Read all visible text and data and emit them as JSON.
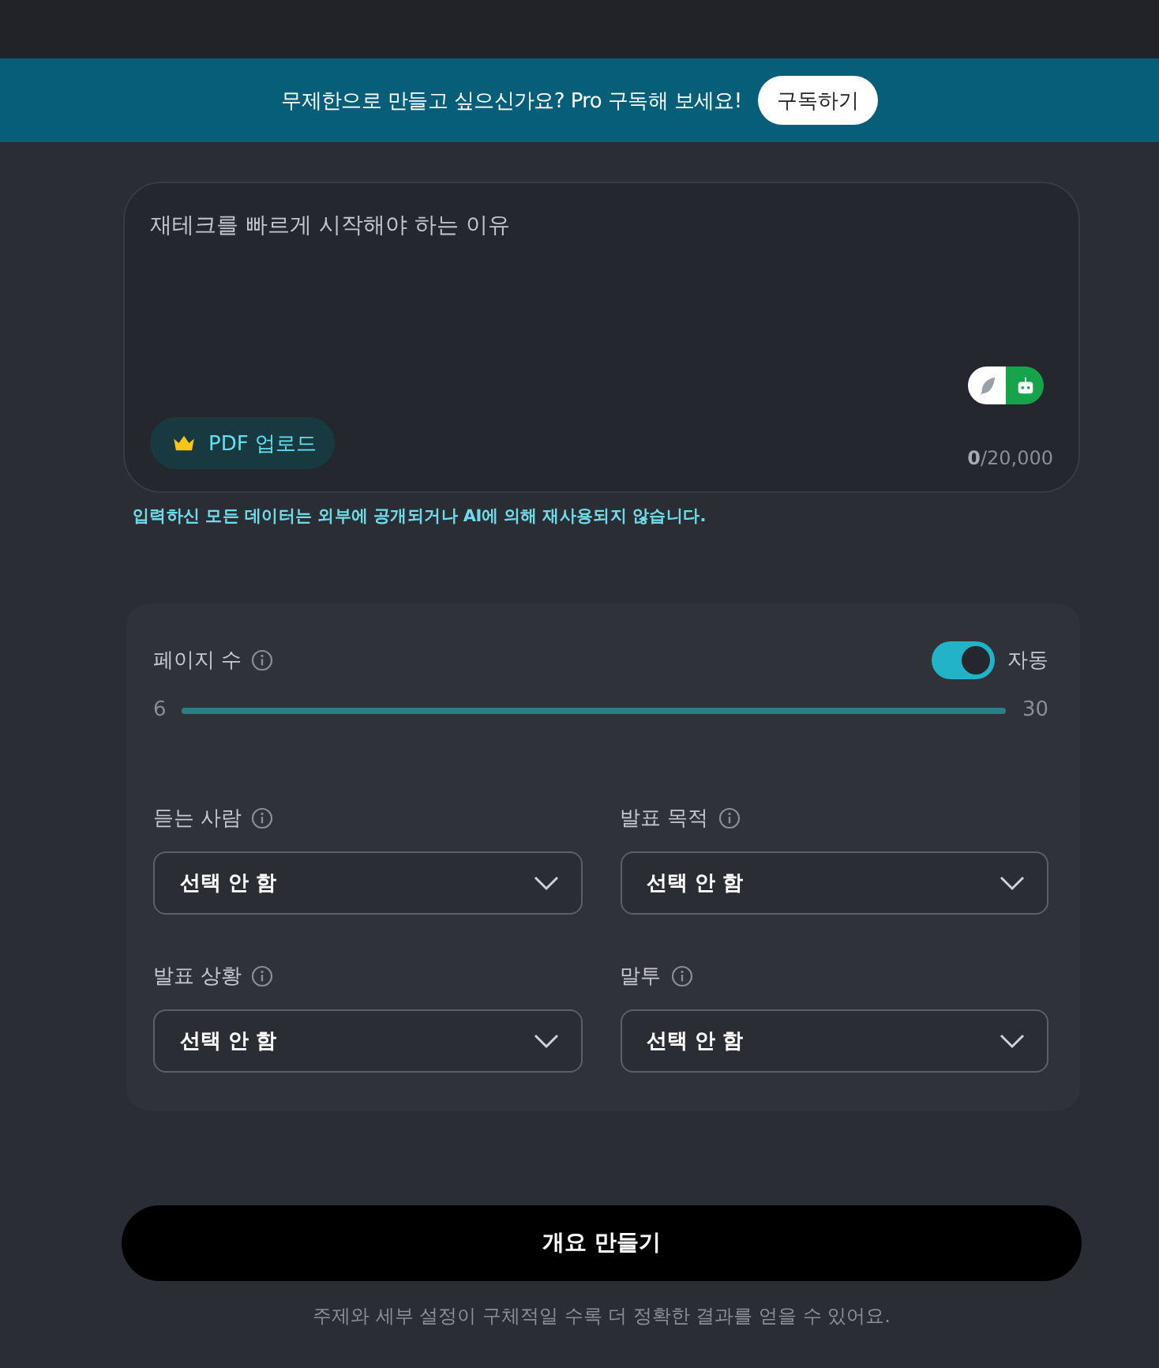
{
  "banner": {
    "message": "무제한으로 만들고 싶으신가요? Pro 구독해 보세요!",
    "button": "구독하기"
  },
  "topic": {
    "placeholder": "재테크를 빠르게 시작해야 하는 이유",
    "modes": [
      {
        "kind": "pen",
        "selected": false
      },
      {
        "kind": "robot",
        "selected": true
      }
    ],
    "upload_button": "PDF 업로드",
    "count": "0",
    "limit": "/20,000"
  },
  "privacy_note": "입력하신 모든 데이터는 외부에 공개되거나 AI에 의해 재사용되지 않습니다.",
  "page_count": {
    "label": "페이지 수",
    "auto_label": "자동",
    "auto": true,
    "min": "6",
    "max": "30",
    "level": 1
  },
  "selects": [
    {
      "label": "듣는 사람",
      "value": "선택 안 함"
    },
    {
      "label": "발표 목적",
      "value": "선택 안 함"
    },
    {
      "label": "발표 상황",
      "value": "선택 안 함"
    },
    {
      "label": "말투",
      "value": "선택 안 함"
    }
  ],
  "submit_button": "개요 만들기",
  "footer_hint": "주제와 세부 설정이 구체적일 수록 더 정확한 결과를 얻을 수 있어요."
}
